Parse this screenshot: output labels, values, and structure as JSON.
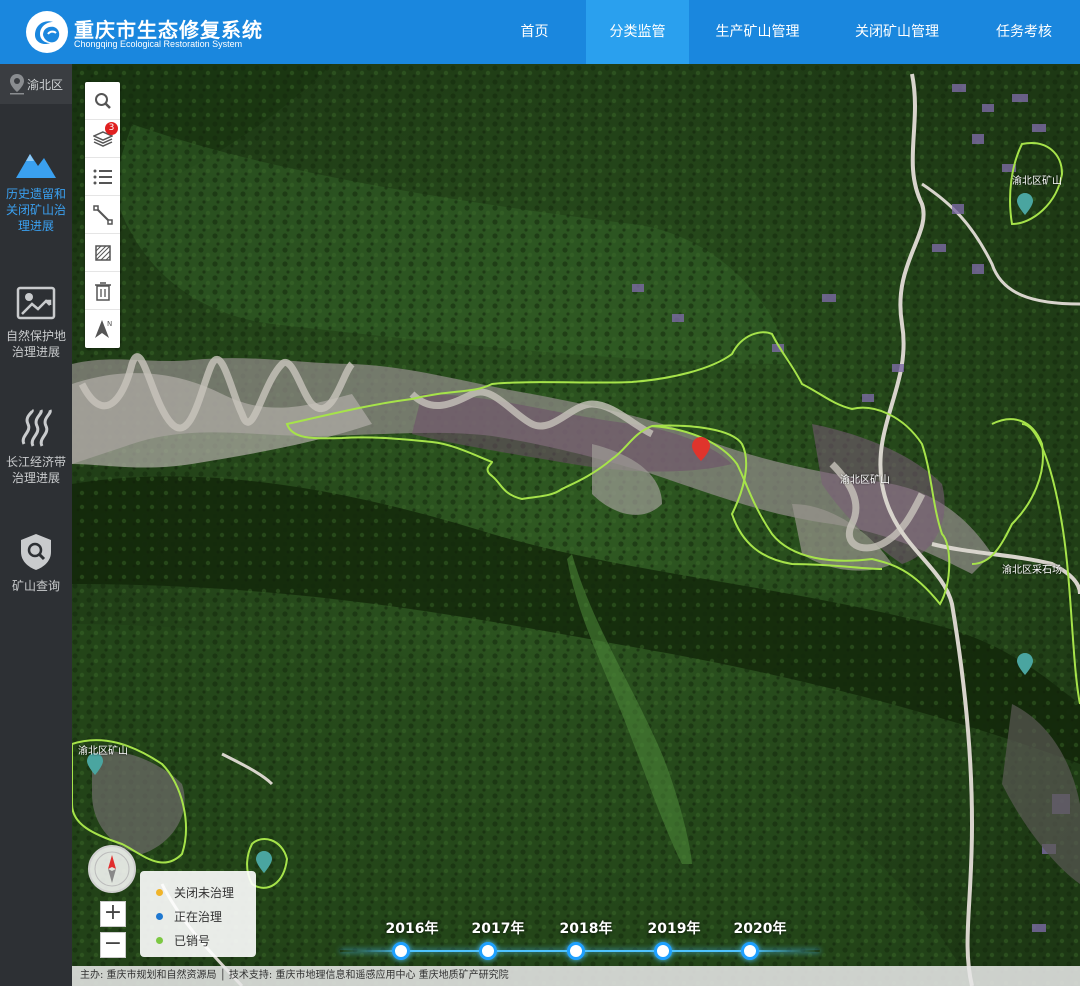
{
  "header": {
    "title": "重庆市生态修复系统",
    "subtitle": "Chongqing Ecological Restoration System",
    "nav": [
      {
        "label": "首页"
      },
      {
        "label": "分类监管"
      },
      {
        "label": "生产矿山管理"
      },
      {
        "label": "关闭矿山管理"
      },
      {
        "label": "任务考核"
      }
    ],
    "active_nav": "分类监管"
  },
  "sidebar": {
    "region": "渝北区",
    "items": [
      {
        "label": "历史遗留和关闭矿山治理进展",
        "icon": "mountain-icon",
        "active": true
      },
      {
        "label": "自然保护地治理进展",
        "icon": "nature-reserve-icon",
        "active": false
      },
      {
        "label": "长江经济带治理进展",
        "icon": "river-icon",
        "active": false
      },
      {
        "label": "矿山查询",
        "icon": "shield-search-icon",
        "active": false
      }
    ]
  },
  "map": {
    "tools": [
      {
        "icon": "search-icon"
      },
      {
        "icon": "layers-icon",
        "badge": "3"
      },
      {
        "icon": "list-icon"
      },
      {
        "icon": "measure-line-icon"
      },
      {
        "icon": "area-icon"
      },
      {
        "icon": "trash-icon"
      },
      {
        "icon": "north-arrow-icon"
      }
    ],
    "zoom_in": "+",
    "zoom_out": "−",
    "legend": [
      {
        "label": "关闭未治理",
        "color": "#f0b429"
      },
      {
        "label": "正在治理",
        "color": "#1e78d0"
      },
      {
        "label": "已销号",
        "color": "#7cc842"
      }
    ],
    "labels": [
      "渝北区矿山",
      "渝北区矿山",
      "渝北区矿山",
      "渝北区采石场"
    ]
  },
  "timeline": {
    "years": [
      "2016年",
      "2017年",
      "2018年",
      "2019年",
      "2020年"
    ],
    "selected": "2017年"
  },
  "footer": {
    "text": "主办: 重庆市规划和自然资源局  │  技术支持: 重庆市地理信息和遥感应用中心 重庆地质矿产研究院"
  },
  "colors": {
    "header_bg": "#1a87de",
    "nav_active_bg": "#2aa0ee",
    "sidebar_bg": "#2d3034",
    "sidebar_active": "#3aa0f0",
    "boundary": "#a6e34a"
  }
}
